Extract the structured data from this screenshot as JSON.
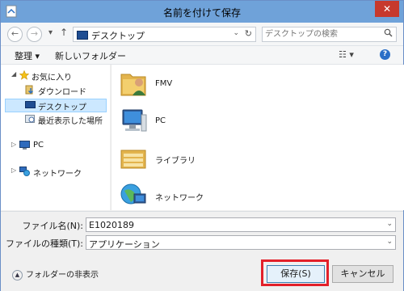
{
  "window": {
    "title": "名前を付けて保存",
    "close_glyph": "✕"
  },
  "nav": {
    "back": "←",
    "forward": "→",
    "dropdown": "▾",
    "up": "↑"
  },
  "address": {
    "path": "デスクトップ",
    "dropdown": "⌄",
    "refresh": "↻"
  },
  "search": {
    "placeholder": "デスクトップの検索",
    "icon": "search-icon"
  },
  "toolbar": {
    "organize_label": "整理 ▾",
    "new_folder_label": "新しいフォルダー",
    "view_label": "☷ ▾",
    "help_label": "?"
  },
  "sidebar": {
    "favorites_label": "お気に入り",
    "items": [
      {
        "label": "ダウンロード",
        "icon": "download-icon"
      },
      {
        "label": "デスクトップ",
        "icon": "desktop-icon",
        "selected": true
      },
      {
        "label": "最近表示した場所",
        "icon": "recent-places-icon"
      }
    ],
    "pc_label": "PC",
    "network_label": "ネットワーク",
    "expanded_arrow": "◢",
    "collapsed_arrow": "▷"
  },
  "content": {
    "items": [
      {
        "label": "FMV",
        "icon": "user-folder-icon"
      },
      {
        "label": "PC",
        "icon": "computer-icon"
      },
      {
        "label": "ライブラリ",
        "icon": "library-icon"
      },
      {
        "label": "ネットワーク",
        "icon": "network-icon"
      }
    ]
  },
  "form": {
    "filename_label": "ファイル名(N):",
    "filename_value": "E1020189",
    "filetype_label": "ファイルの種類(T):",
    "filetype_value": "アプリケーション",
    "dropdown": "⌄"
  },
  "footer": {
    "hide_folders_label": "フォルダーの非表示",
    "hide_folders_glyph": "▲",
    "save_label": "保存(S)",
    "cancel_label": "キャンセル"
  },
  "colors": {
    "titlebar": "#6fa2d9",
    "close": "#c7392d",
    "highlight": "#e3202a",
    "selection": "#cce8ff"
  }
}
